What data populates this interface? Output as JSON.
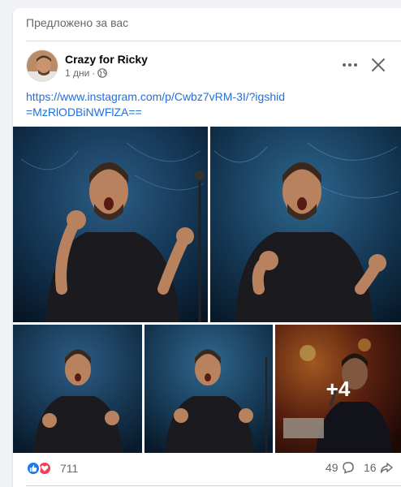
{
  "feed": {
    "suggested_label": "Предложено за вас"
  },
  "post": {
    "author": "Crazy for Ricky",
    "time": "1 дни",
    "separator": "·",
    "privacy_icon": "globe-icon",
    "link_text": "https://www.instagram.com/p/Cwbz7vRM-3I/?igshid=MzRlODBiNWFlZA==",
    "more_photos": "+4",
    "reactions_count": "711",
    "comments_count": "49",
    "shares_count": "16"
  },
  "colors": {
    "link": "#216fdb",
    "like": "#1877f2",
    "love": "#f33e58",
    "muted": "#65676b"
  }
}
